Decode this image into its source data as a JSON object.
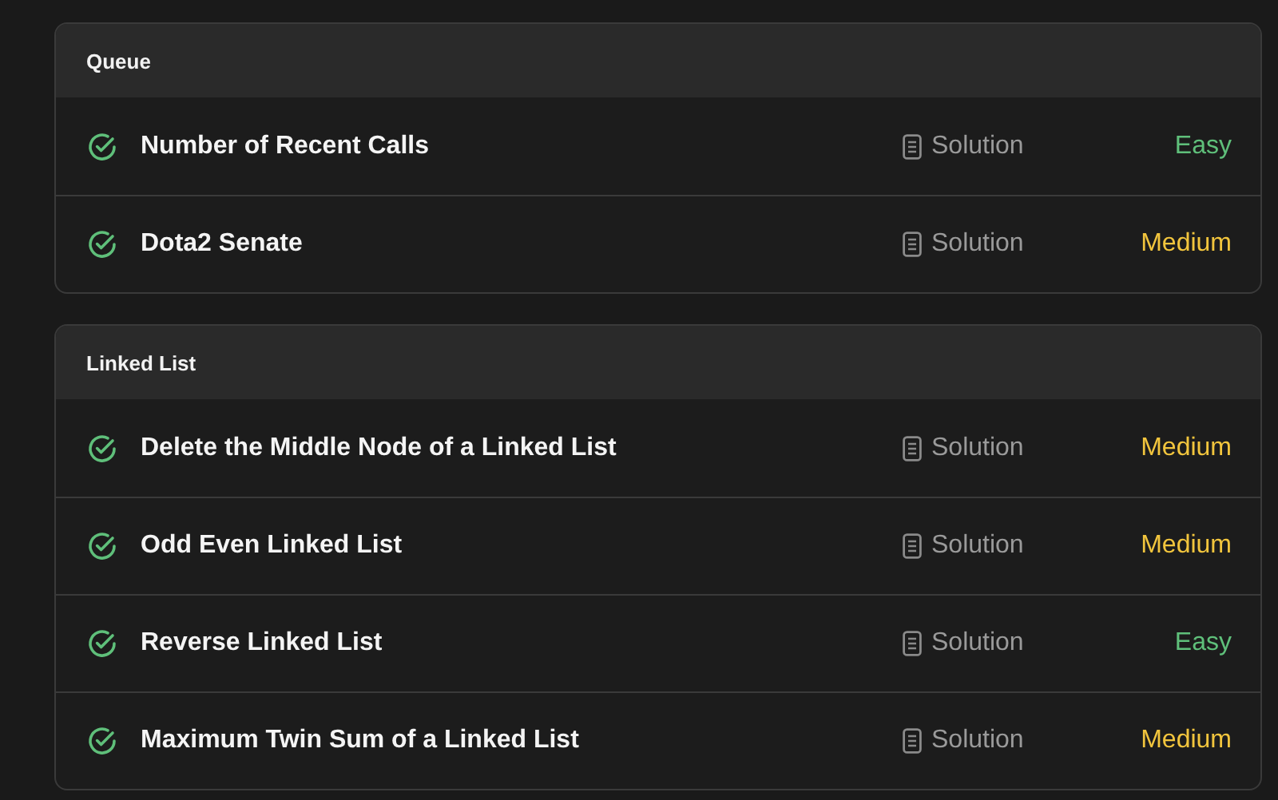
{
  "sections": [
    {
      "title": "Queue",
      "problems": [
        {
          "title": "Number of Recent Calls",
          "solved": true,
          "solution": "Solution",
          "difficulty": "Easy",
          "kind": "easy"
        },
        {
          "title": "Dota2 Senate",
          "solved": true,
          "solution": "Solution",
          "difficulty": "Medium",
          "kind": "medium"
        }
      ]
    },
    {
      "title": "Linked List",
      "problems": [
        {
          "title": "Delete the Middle Node of a Linked List",
          "solved": true,
          "solution": "Solution",
          "difficulty": "Medium",
          "kind": "medium"
        },
        {
          "title": "Odd Even Linked List",
          "solved": true,
          "solution": "Solution",
          "difficulty": "Medium",
          "kind": "medium"
        },
        {
          "title": "Reverse Linked List",
          "solved": true,
          "solution": "Solution",
          "difficulty": "Easy",
          "kind": "easy"
        },
        {
          "title": "Maximum Twin Sum of a Linked List",
          "solved": true,
          "solution": "Solution",
          "difficulty": "Medium",
          "kind": "medium"
        }
      ]
    }
  ]
}
